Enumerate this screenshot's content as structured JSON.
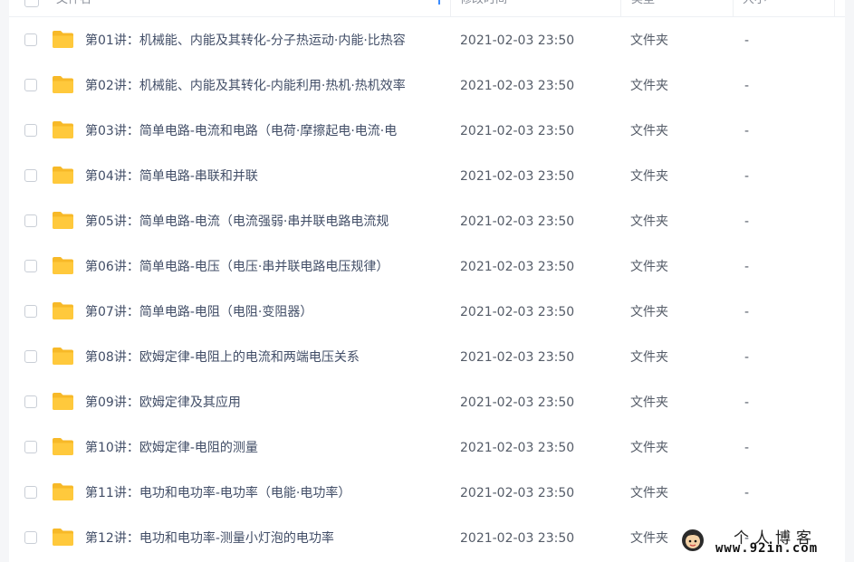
{
  "header": {
    "name_label": "文件名",
    "mtime_label": "修改时间",
    "type_label": "类型",
    "size_label": "大小"
  },
  "colors": {
    "folder": "#ffc93c",
    "folder_dark": "#f7b928",
    "text": "#424e67",
    "sort_accent": "#3b8cff"
  },
  "rows": [
    {
      "name": "第01讲：机械能、内能及其转化-分子热运动·内能·比热容",
      "mtime": "2021-02-03 23:50",
      "type": "文件夹",
      "size": "-"
    },
    {
      "name": "第02讲：机械能、内能及其转化-内能利用·热机·热机效率",
      "mtime": "2021-02-03 23:50",
      "type": "文件夹",
      "size": "-"
    },
    {
      "name": "第03讲：简单电路-电流和电路（电荷·摩擦起电·电流·电",
      "mtime": "2021-02-03 23:50",
      "type": "文件夹",
      "size": "-"
    },
    {
      "name": "第04讲：简单电路-串联和并联",
      "mtime": "2021-02-03 23:50",
      "type": "文件夹",
      "size": "-"
    },
    {
      "name": "第05讲：简单电路-电流（电流强弱·串并联电路电流规",
      "mtime": "2021-02-03 23:50",
      "type": "文件夹",
      "size": "-"
    },
    {
      "name": "第06讲：简单电路-电压（电压·串并联电路电压规律）",
      "mtime": "2021-02-03 23:50",
      "type": "文件夹",
      "size": "-"
    },
    {
      "name": "第07讲：简单电路-电阻（电阻·变阻器）",
      "mtime": "2021-02-03 23:50",
      "type": "文件夹",
      "size": "-"
    },
    {
      "name": "第08讲：欧姆定律-电阻上的电流和两端电压关系",
      "mtime": "2021-02-03 23:50",
      "type": "文件夹",
      "size": "-"
    },
    {
      "name": "第09讲：欧姆定律及其应用",
      "mtime": "2021-02-03 23:50",
      "type": "文件夹",
      "size": "-"
    },
    {
      "name": "第10讲：欧姆定律-电阻的测量",
      "mtime": "2021-02-03 23:50",
      "type": "文件夹",
      "size": "-"
    },
    {
      "name": "第11讲：电功和电功率-电功率（电能·电功率）",
      "mtime": "2021-02-03 23:50",
      "type": "文件夹",
      "size": "-"
    },
    {
      "name": "第12讲：电功和电功率-测量小灯泡的电功率",
      "mtime": "2021-02-03 23:50",
      "type": "文件夹",
      "size": "-"
    }
  ],
  "watermark": {
    "title": "个人博客",
    "url": "www.92in.com"
  }
}
